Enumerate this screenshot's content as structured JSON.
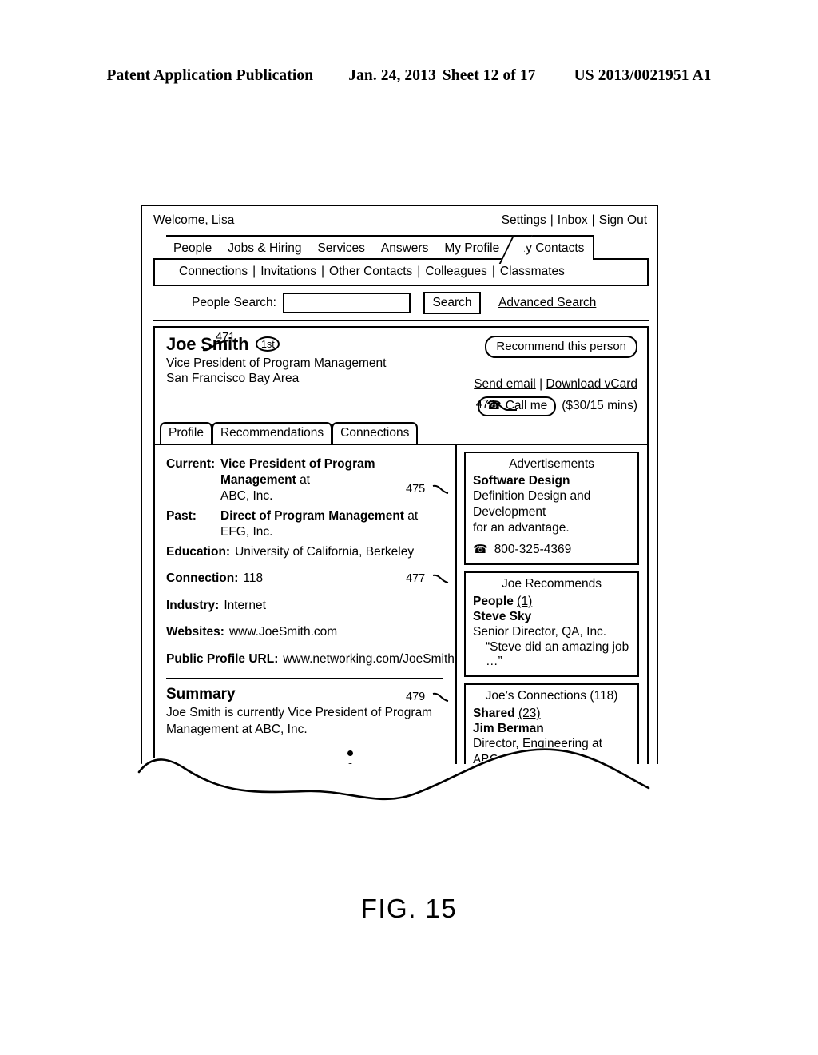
{
  "patent_header": {
    "publication": "Patent Application Publication",
    "date": "Jan. 24, 2013",
    "sheet": "Sheet 12 of 17",
    "number": "US 2013/0021951 A1"
  },
  "figure": {
    "caption": "FIG. 15"
  },
  "window": {
    "welcome": "Welcome, Lisa",
    "account_links": [
      {
        "label": "Settings"
      },
      {
        "label": "Inbox"
      },
      {
        "label": "Sign Out"
      }
    ],
    "link_separator": "|"
  },
  "main_tabs": [
    {
      "label": "People",
      "active": false
    },
    {
      "label": "Jobs & Hiring",
      "active": false
    },
    {
      "label": "Services",
      "active": false
    },
    {
      "label": "Answers",
      "active": false
    },
    {
      "label": "My Profile",
      "active": false
    },
    {
      "label": "My Contacts",
      "active": true
    }
  ],
  "subnav": {
    "items": [
      {
        "label": "Connections"
      },
      {
        "label": "Invitations"
      },
      {
        "label": "Other Contacts"
      },
      {
        "label": "Colleagues"
      },
      {
        "label": "Classmates"
      }
    ],
    "separator": "|"
  },
  "search": {
    "label": "People Search:",
    "value": "",
    "placeholder": "",
    "button_label": "Search",
    "advanced_label": "Advanced Search"
  },
  "profile": {
    "name": "Joe Smith",
    "degree_badge": "1st",
    "headline": "Vice President of Program Management",
    "location": "San Francisco Bay Area",
    "recommend_button": "Recommend this person",
    "send_email_label": "Send email",
    "download_vcard_label": "Download vCard",
    "call_button_label": "Call me",
    "call_rate": "($30/15 mins)",
    "phone_icon": "☎",
    "sub_tabs": [
      {
        "label": "Profile",
        "active": true
      },
      {
        "label": "Recommendations",
        "active": false
      },
      {
        "label": "Connections",
        "active": false
      }
    ]
  },
  "details": {
    "current_label": "Current:",
    "current_title": "Vice President of Program Management",
    "current_at": "at",
    "current_company": "ABC, Inc.",
    "past_label": "Past:",
    "past_title": "Direct of Program Management",
    "past_at": "at",
    "past_company": "EFG, Inc.",
    "education_label": "Education:",
    "education_value": "University of California, Berkeley",
    "connection_label": "Connection:",
    "connection_value": "118",
    "industry_label": "Industry:",
    "industry_value": "Internet",
    "websites_label": "Websites:",
    "websites_value": "www.JoeSmith.com",
    "public_url_label": "Public Profile URL:",
    "public_url_value": "www.networking.com/JoeSmith"
  },
  "summary": {
    "heading": "Summary",
    "text": "Joe Smith is currently Vice President of Program Management at ABC, Inc."
  },
  "advertisements": {
    "title": "Advertisements",
    "ad_title": "Software Design",
    "ad_line1": "Definition Design and Development",
    "ad_line2": "for an advantage.",
    "phone_icon": "☎",
    "phone": "800-325-4369"
  },
  "recommends": {
    "title": "Joe Recommends",
    "people_label": "People",
    "people_count": "(1)",
    "person_name": "Steve Sky",
    "person_title": "Senior Director, QA, Inc.",
    "quote": "“Steve did an amazing job …”"
  },
  "connections": {
    "title": "Joe’s Connections (118)",
    "shared_label": "Shared",
    "shared_count": "(23)",
    "person_name": "Jim Berman",
    "person_title": "Director, Engineering at ABC, Inc."
  },
  "callouts": {
    "ref_471": "471",
    "ref_473": "473",
    "ref_475": "475",
    "ref_477": "477",
    "ref_479": "479"
  },
  "colors": {
    "ink": "#000000",
    "paper": "#ffffff"
  }
}
